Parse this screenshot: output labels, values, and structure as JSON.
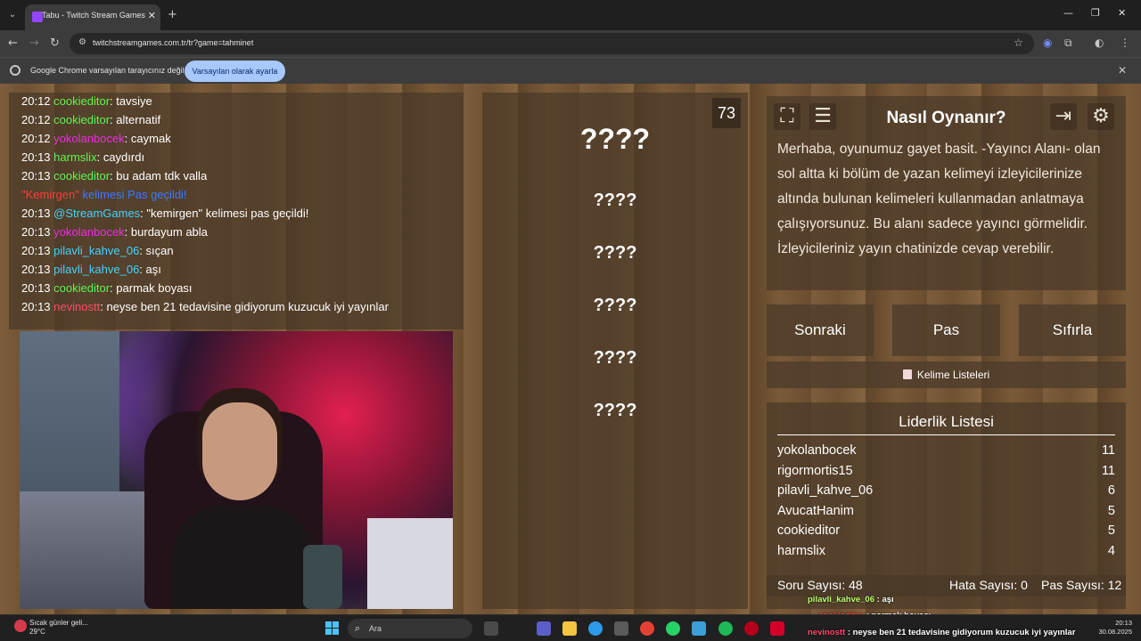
{
  "browser": {
    "tab_title": "Tabu - Twitch Stream Games",
    "url": "twitchstreamgames.com.tr/tr?game=tahminet",
    "infobar_text": "Google Chrome varsayılan tarayıcınız değil",
    "infobar_button": "Varsayılan olarak ayarla"
  },
  "chat": [
    {
      "time": "20:12",
      "user": "cookieditor",
      "sep": ": ",
      "msg": "tavsiye",
      "color": "#5ff54f"
    },
    {
      "time": "20:12",
      "user": "cookieditor",
      "sep": ": ",
      "msg": "alternatif",
      "color": "#5ff54f"
    },
    {
      "time": "20:12",
      "user": "yokolanbocek",
      "sep": ": ",
      "msg": "caymak",
      "color": "#ea2fe0"
    },
    {
      "time": "20:13",
      "user": "harmslix",
      "sep": ": ",
      "msg": "caydırdı",
      "color": "#5ff54f"
    },
    {
      "time": "20:13",
      "user": "cookieditor",
      "sep": ": ",
      "msg": "bu adam tdk valla",
      "color": "#5ff54f"
    },
    {
      "time": "",
      "user": "\"Kemirgen\"",
      "sep": " ",
      "msg": "kelimesi Pas geçildi!",
      "color": "#ff3b3b",
      "special": true
    },
    {
      "time": "20:13",
      "user": "@StreamGames",
      "sep": ": ",
      "msg": "\"kemirgen\" kelimesi pas geçildi!",
      "color": "#3fd4ff"
    },
    {
      "time": "20:13",
      "user": "yokolanbocek",
      "sep": ": ",
      "msg": "burdayum abla",
      "color": "#ea2fe0"
    },
    {
      "time": "20:13",
      "user": "pilavli_kahve_06",
      "sep": ": ",
      "msg": "sıçan",
      "color": "#3fd4ff"
    },
    {
      "time": "20:13",
      "user": "pilavli_kahve_06",
      "sep": ": ",
      "msg": "aşı",
      "color": "#3fd4ff"
    },
    {
      "time": "20:13",
      "user": "cookieditor",
      "sep": ": ",
      "msg": "parmak boyası",
      "color": "#5ff54f"
    },
    {
      "time": "20:13",
      "user": "nevinostt",
      "sep": ": ",
      "msg": "neyse ben 21 tedavisine gidiyorum kuzucuk iyi yayınlar",
      "color": "#ff4a6a"
    }
  ],
  "game": {
    "timer": "73",
    "main_word": "????",
    "forbidden_words": [
      "????",
      "????",
      "????",
      "????",
      "????"
    ]
  },
  "howto": {
    "title": "Nasıl Oynanır?",
    "text": "Merhaba, oyunumuz gayet basit. -Yayıncı Alanı- olan sol altta ki bölüm de yazan kelimeyi izleyicilerinize altında bulunan kelimeleri kullanmadan anlatmaya çalışıyorsunuz. Bu alanı sadece yayıncı görmelidir. İzleyicileriniz yayın chatinizde cevap verebilir."
  },
  "actions": {
    "next": "Sonraki",
    "pass": "Pas",
    "reset": "Sıfırla",
    "word_lists": "Kelime Listeleri"
  },
  "leaderboard": {
    "title": "Liderlik Listesi",
    "rows": [
      {
        "name": "yokolanbocek",
        "score": "11"
      },
      {
        "name": "rigormortis15",
        "score": "11"
      },
      {
        "name": "pilavli_kahve_06",
        "score": "6"
      },
      {
        "name": "AvucatHanim",
        "score": "5"
      },
      {
        "name": "cookieditor",
        "score": "5"
      },
      {
        "name": "harmslix",
        "score": "4"
      }
    ]
  },
  "stats": {
    "questions": "Soru Sayısı: 48",
    "errors": "Hata Sayısı: 0",
    "passes": "Pas Sayısı: 12"
  },
  "overlay": [
    {
      "user": "pilavli_kahve_06",
      "msg": " : aşı",
      "color": "#b9ff6a"
    },
    {
      "user": "cookieditor",
      "msg": " : parmak boyası",
      "color": "#ff3b3b"
    },
    {
      "user": "nevinostt",
      "msg": " : neyse ben 21 tedavisine gidiyorum kuzucuk iyi yayınlar",
      "color": "#ff4a6a"
    }
  ],
  "taskbar": {
    "weather_title": "Sıcak günler geli...",
    "weather_temp": "29°C",
    "search_placeholder": "Ara",
    "time": "20:13",
    "date": "30.08.2025"
  }
}
